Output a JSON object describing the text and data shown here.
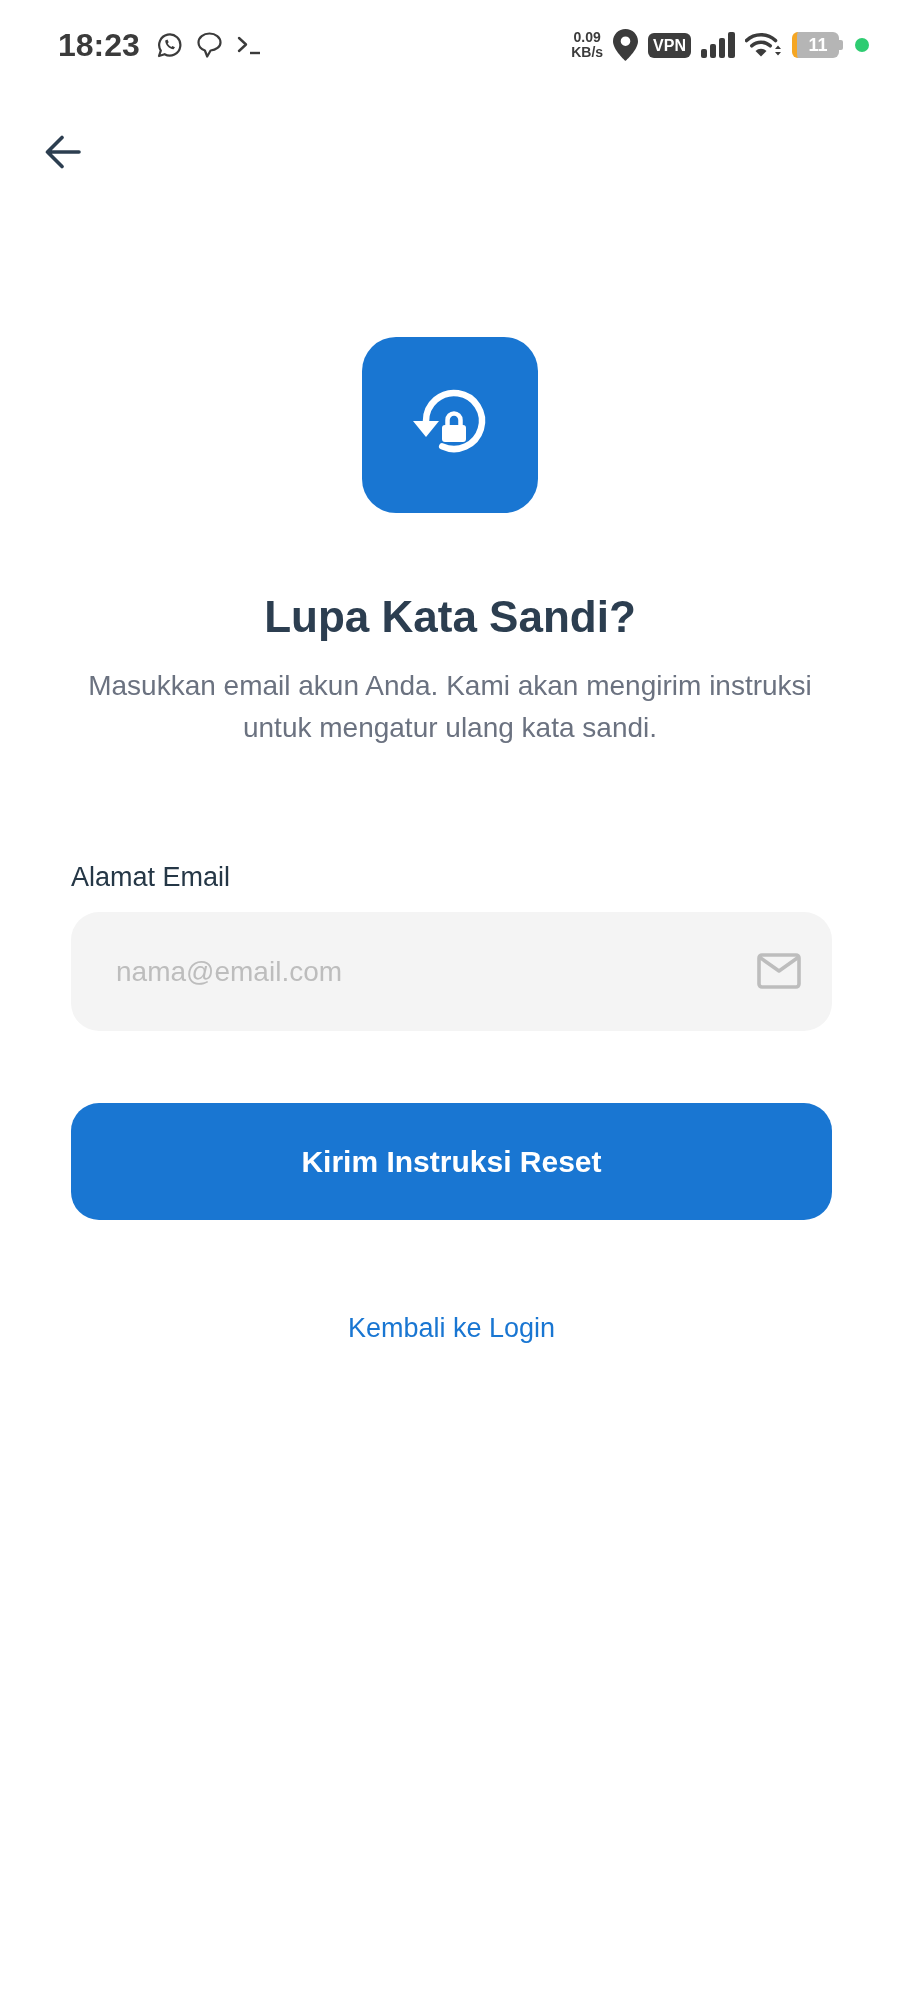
{
  "status_bar": {
    "time": "18:23",
    "network_speed": {
      "value": "0.09",
      "unit": "KB/s"
    },
    "vpn": "VPN",
    "battery": "11"
  },
  "hero": {
    "title": "Lupa Kata Sandi?",
    "description": "Masukkan email akun Anda. Kami akan mengirim instruksi untuk mengatur ulang kata sandi."
  },
  "form": {
    "email_field": {
      "label": "Alamat Email",
      "placeholder": "nama@email.com"
    },
    "submit_button": "Kirim Instruksi Reset",
    "back_link": "Kembali ke Login"
  }
}
